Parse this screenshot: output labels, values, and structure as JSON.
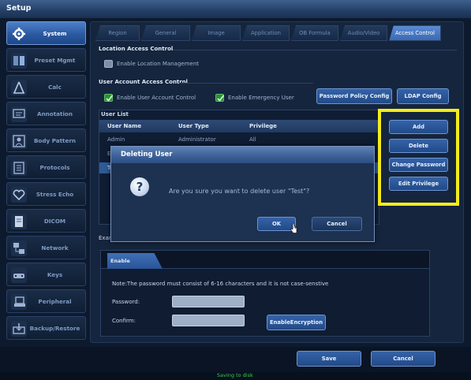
{
  "window": {
    "title": "Setup"
  },
  "sidebar": {
    "items": [
      {
        "label": "System",
        "icon": "gear-icon",
        "active": true
      },
      {
        "label": "Preset Mgmt",
        "icon": "preset-icon"
      },
      {
        "label": "Calc",
        "icon": "calc-icon"
      },
      {
        "label": "Annotation",
        "icon": "annotation-icon"
      },
      {
        "label": "Body Pattern",
        "icon": "body-pattern-icon"
      },
      {
        "label": "Protocols",
        "icon": "protocols-icon"
      },
      {
        "label": "Stress Echo",
        "icon": "heart-icon"
      },
      {
        "label": "DICOM",
        "icon": "dicom-icon"
      },
      {
        "label": "Network",
        "icon": "network-icon"
      },
      {
        "label": "Keys",
        "icon": "keys-icon"
      },
      {
        "label": "Peripheral",
        "icon": "peripheral-icon"
      },
      {
        "label": "Backup/Restore",
        "icon": "backup-icon"
      }
    ]
  },
  "tabs": [
    {
      "label": "Region"
    },
    {
      "label": "General"
    },
    {
      "label": "Image"
    },
    {
      "label": "Application"
    },
    {
      "label": "OB Formula"
    },
    {
      "label": "Audio/Video"
    },
    {
      "label": "Access Control",
      "active": true
    }
  ],
  "location_access": {
    "title": "Location Access Control",
    "enable_label": "Enable Location Management",
    "checked": false
  },
  "user_access": {
    "title": "User Account Access Control",
    "enable_user_label": "Enable User Account Control",
    "enable_user_checked": true,
    "enable_emergency_label": "Enable Emergency User",
    "enable_emergency_checked": true,
    "password_policy_button": "Password Policy Config",
    "ldap_button": "LDAP Config"
  },
  "user_list": {
    "title": "User List",
    "columns": [
      "User Name",
      "User Type",
      "Privilege"
    ],
    "rows": [
      {
        "name": "Admin",
        "type": "Administrator",
        "privilege": "All"
      },
      {
        "name": "Em",
        "type": "",
        "privilege": ""
      },
      {
        "name": "Te",
        "type": "",
        "privilege": ""
      }
    ]
  },
  "actions": {
    "add": "Add",
    "delete": "Delete",
    "change_password": "Change Password",
    "edit_privilege": "Edit Privilege"
  },
  "encryption": {
    "section_label": "Exam",
    "tab_label": "Enable Encryption",
    "note": "Note:The password must consist of 6-16 characters and it is not case-senstive",
    "password_label": "Password:",
    "confirm_label": "Confirm:",
    "password_value": "",
    "confirm_value": "",
    "button": "EnableEncryption"
  },
  "footer": {
    "save": "Save",
    "cancel": "Cancel",
    "status": "Saving to disk"
  },
  "dialog": {
    "title": "Deleting User",
    "icon": "question-icon",
    "message": "Are you sure you want to delete user \"Test\"?",
    "ok": "OK",
    "cancel": "Cancel"
  },
  "colors": {
    "highlight": "#f5ec1b",
    "accent": "#3563a8",
    "active_tab": "#5a8bd2"
  }
}
